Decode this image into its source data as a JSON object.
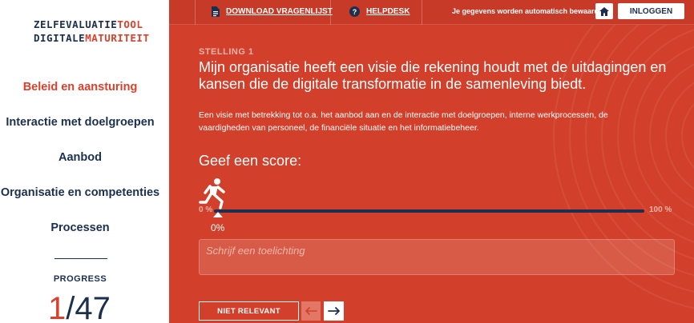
{
  "logo": {
    "line1_dark": "ZELFEVALUATIE",
    "line1_red": "TOOL",
    "line2_dark": "DIGITALE",
    "line2_red": "MATURITEIT"
  },
  "sidebar": {
    "items": [
      {
        "label": "Beleid en aansturing",
        "active": true
      },
      {
        "label": "Interactie met doelgroepen",
        "active": false
      },
      {
        "label": "Aanbod",
        "active": false
      },
      {
        "label": "Organisatie en competenties",
        "active": false
      },
      {
        "label": "Processen",
        "active": false
      }
    ],
    "progress_label": "PROGRESS",
    "progress_current": "1",
    "progress_separator": "/",
    "progress_total": "47"
  },
  "topbar": {
    "download_label": "DOWNLOAD VRAGENLIJST",
    "download_icon": "document-icon",
    "helpdesk_label": "HELPDESK",
    "helpdesk_icon": "question-circle-icon",
    "autosave_text": "Je gegevens worden automatisch bewaard",
    "home_icon": "home-icon",
    "login_label": "INLOGGEN"
  },
  "statement": {
    "number_label": "STELLING 1",
    "question": "Mijn organisatie heeft een visie die rekening houdt met de uitdagingen en kansen die de digitale transformatie in de samenleving biedt.",
    "explanation": "Een visie met betrekking tot o.a. het aanbod aan en de interactie met doelgroepen, interne werkprocessen, de vaardigheden van personeel, de financiële situatie en het informatiebeheer."
  },
  "score": {
    "label": "Geef een score:",
    "min_label": "0 %",
    "max_label": "100 %",
    "value_label": "0%",
    "value_fraction": 0,
    "icon": "running-person-icon"
  },
  "comment": {
    "placeholder": "Schrijf een toelichting",
    "value": ""
  },
  "actions": {
    "not_relevant_label": "NIET RELEVANT",
    "prev_icon": "arrow-left-icon",
    "next_icon": "arrow-right-icon"
  },
  "colors": {
    "primary_red": "#d2402b",
    "navy": "#1b2f4e",
    "white": "#ffffff"
  }
}
